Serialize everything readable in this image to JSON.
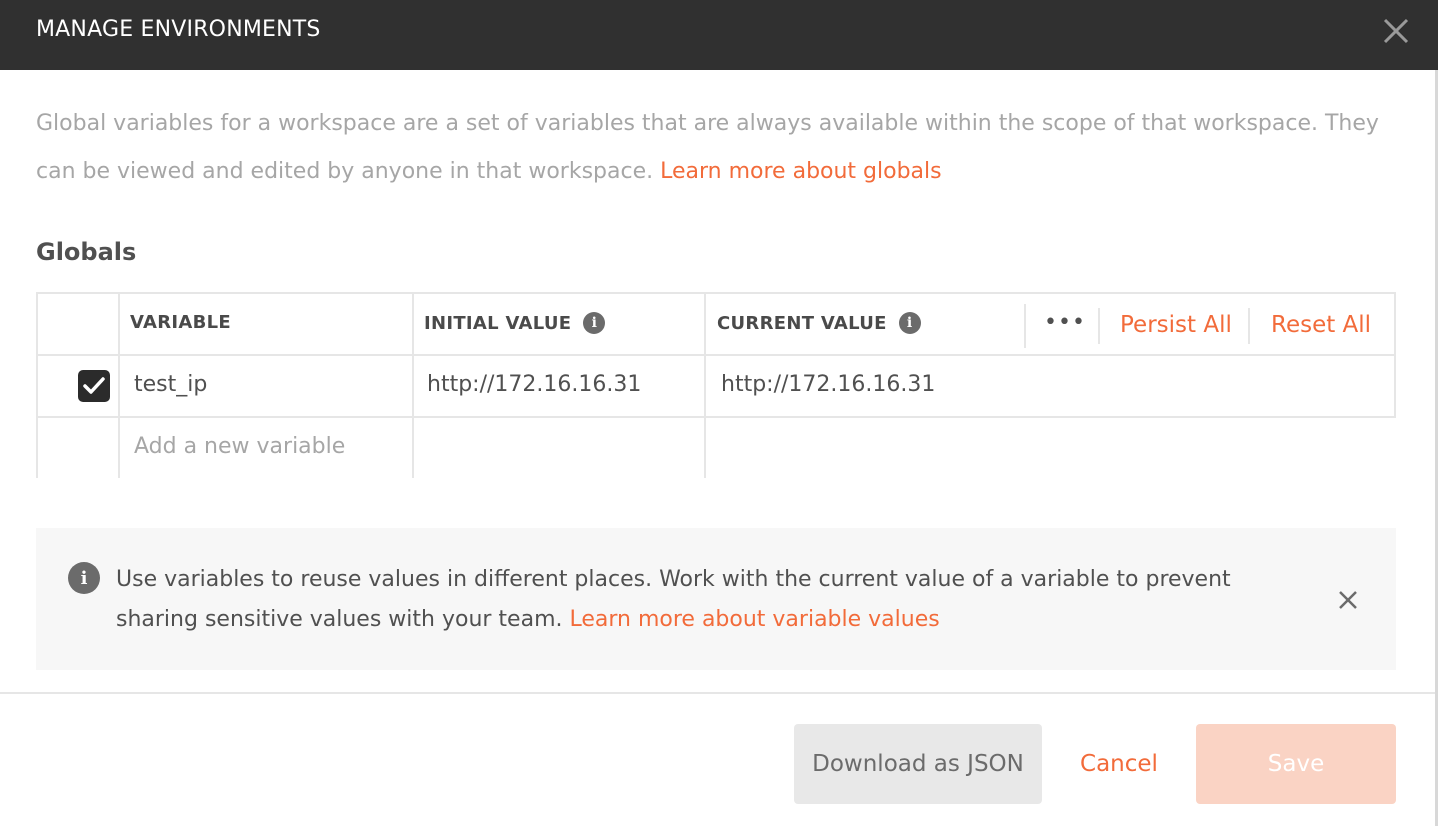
{
  "header": {
    "title": "MANAGE ENVIRONMENTS"
  },
  "description": {
    "text": "Global variables for a workspace are a set of variables that are always available within the scope of that workspace. They can be viewed and edited by anyone in that workspace. ",
    "link": "Learn more about globals"
  },
  "section_title": "Globals",
  "table": {
    "columns": {
      "variable": "VARIABLE",
      "initial_value": "INITIAL VALUE",
      "current_value": "CURRENT VALUE"
    },
    "actions": {
      "more": "•••",
      "persist_all": "Persist All",
      "reset_all": "Reset All"
    },
    "rows": [
      {
        "enabled": true,
        "variable": "test_ip",
        "initial_value": "http://172.16.16.31",
        "current_value": "http://172.16.16.31"
      }
    ],
    "new_row_placeholder": "Add a new variable"
  },
  "banner": {
    "text": "Use variables to reuse values in different places. Work with the current value of a variable to prevent sharing sensitive values with your team. ",
    "link": "Learn more about variable values"
  },
  "footer": {
    "download_label": "Download as JSON",
    "cancel_label": "Cancel",
    "save_label": "Save"
  },
  "colors": {
    "accent": "#f26b3a",
    "header_bg": "#303030",
    "save_disabled": "#fad3c4"
  }
}
